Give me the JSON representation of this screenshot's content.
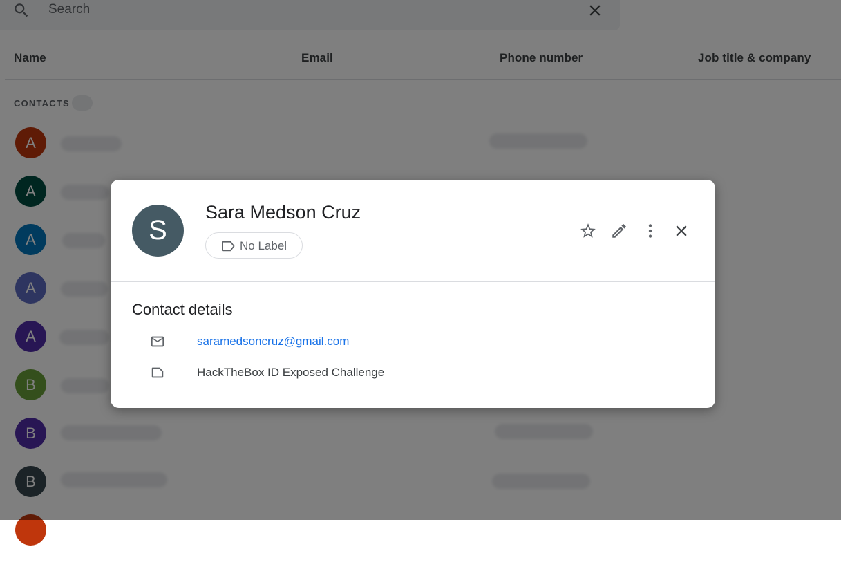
{
  "search": {
    "placeholder": "Search"
  },
  "columns": {
    "name": "Name",
    "email": "Email",
    "phone": "Phone number",
    "job": "Job title & company"
  },
  "contacts_section": {
    "label": "CONTACTS"
  },
  "contact_rows": [
    {
      "initial": "A",
      "color": "#bf360c"
    },
    {
      "initial": "A",
      "color": "#004d40"
    },
    {
      "initial": "A",
      "color": "#0277bd"
    },
    {
      "initial": "A",
      "color": "#5c6bc0"
    },
    {
      "initial": "A",
      "color": "#512da8"
    },
    {
      "initial": "B",
      "color": "#689f38"
    },
    {
      "initial": "B",
      "color": "#512da8"
    },
    {
      "initial": "B",
      "color": "#37474f"
    }
  ],
  "dialog": {
    "avatar_initial": "S",
    "avatar_color": "#455a64",
    "name": "Sara Medson Cruz",
    "label_chip": "No Label",
    "details_title": "Contact details",
    "email": "saramedsoncruz@gmail.com",
    "note": "HackTheBox ID Exposed Challenge"
  },
  "icons": {
    "star": "star-icon",
    "edit": "pencil-icon",
    "more": "more-vert-icon",
    "close": "close-icon",
    "mail": "mail-icon",
    "note": "note-icon",
    "label": "label-icon",
    "search": "search-icon"
  },
  "colors": {
    "link": "#1a73e8",
    "scrim": "rgba(0,0,0,0.5)"
  }
}
